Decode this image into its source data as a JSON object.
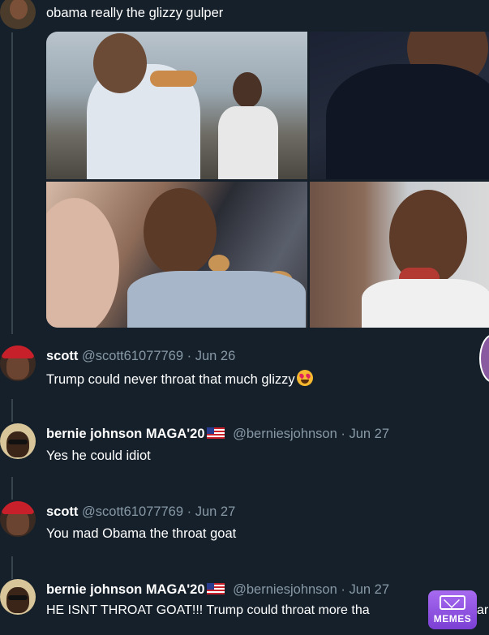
{
  "original_tweet": {
    "text": "obama really the glizzy gulper",
    "avatar_icon": "user-avatar-icon",
    "photos": [
      "photo-1",
      "photo-2",
      "photo-3",
      "photo-4"
    ]
  },
  "replies": [
    {
      "name": "scott",
      "handle": "@scott61077769",
      "separator": "·",
      "date": "Jun 26",
      "text": "Trump could never throat that much glizzy",
      "has_flag": false,
      "emoji": "heart-eyes-emoji"
    },
    {
      "name": "bernie johnson MAGA'20",
      "handle": "@berniesjohnson",
      "separator": "·",
      "date": "Jun 27",
      "text": "Yes he could idiot",
      "has_flag": true
    },
    {
      "name": "scott",
      "handle": "@scott61077769",
      "separator": "·",
      "date": "Jun 27",
      "text": "You mad Obama the throat goat",
      "has_flag": false
    },
    {
      "name": "bernie johnson MAGA'20",
      "handle": "@berniesjohnson",
      "separator": "·",
      "date": "Jun 27",
      "text": "HE ISNT THROAT GOAT!!! Trump could throat more tha",
      "text_tail": "ar",
      "has_flag": true
    }
  ],
  "watermark": {
    "label": "MEMES",
    "icon": "memes-envelope-icon",
    "color": "#8e52e0"
  },
  "colors": {
    "background": "#15202b",
    "secondary_text": "#8899a6",
    "thread_line": "#38444d"
  }
}
